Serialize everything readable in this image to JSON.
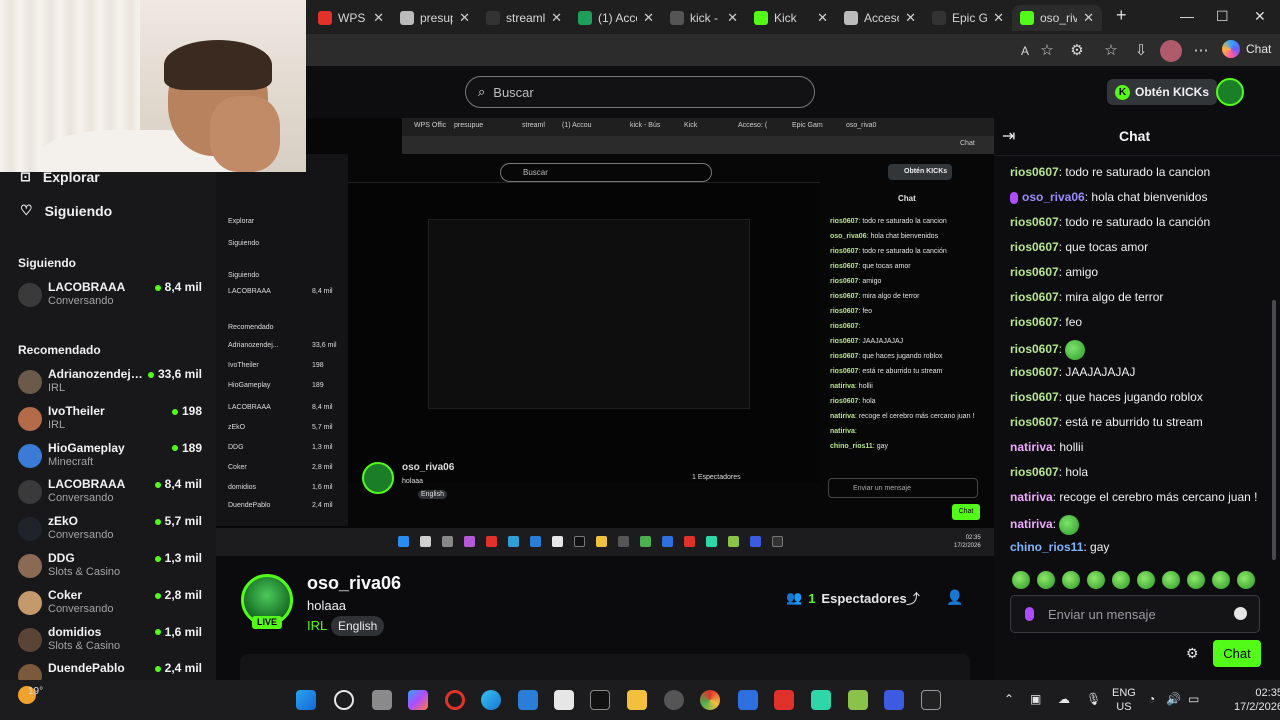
{
  "browser": {
    "tabs": [
      {
        "title": "WPS Offic",
        "color": "#e0322b"
      },
      {
        "title": "presupue",
        "color": "#bbbbbb"
      },
      {
        "title": "streaml",
        "color": "#333333"
      },
      {
        "title": "(1) Accou",
        "color": "#1f9e5a"
      },
      {
        "title": "kick - Bús",
        "color": "#555555"
      },
      {
        "title": "Kick",
        "color": "#53fc18"
      },
      {
        "title": "Acceso: (",
        "color": "#bbbbbb"
      },
      {
        "title": "Epic Gam",
        "color": "#333333"
      },
      {
        "title": "oso_riva0",
        "color": "#53fc18"
      }
    ],
    "copilot_label": "Chat"
  },
  "nav": {
    "search_placeholder": "Buscar",
    "get_kicks_label": "Obtén KICKs"
  },
  "sidebar": {
    "explore_label": "Explorar",
    "following_label": "Siguiendo",
    "following_section": "Siguiendo",
    "recommended_section": "Recomendado",
    "following": [
      {
        "name": "LACOBRAAA",
        "category": "Conversando",
        "viewers": "8,4 mil",
        "avatar_color": "#3a3a3a"
      }
    ],
    "recommended": [
      {
        "name": "Adrianozendejas",
        "category": "IRL",
        "viewers": "33,6 mil",
        "avatar_color": "#6b5a4a"
      },
      {
        "name": "IvoTheiler",
        "category": "IRL",
        "viewers": "198",
        "avatar_color": "#b36b4a"
      },
      {
        "name": "HioGameplay",
        "category": "Minecraft",
        "viewers": "189",
        "avatar_color": "#3b7bd6"
      },
      {
        "name": "LACOBRAAA",
        "category": "Conversando",
        "viewers": "8,4 mil",
        "avatar_color": "#3a3a3a"
      },
      {
        "name": "zEkO",
        "category": "Conversando",
        "viewers": "5,7 mil",
        "avatar_color": "#20232a"
      },
      {
        "name": "DDG",
        "category": "Slots & Casino",
        "viewers": "1,3 mil",
        "avatar_color": "#8a6a55"
      },
      {
        "name": "Coker",
        "category": "Conversando",
        "viewers": "2,8 mil",
        "avatar_color": "#c49a6c"
      },
      {
        "name": "domidios",
        "category": "Slots & Casino",
        "viewers": "1,6 mil",
        "avatar_color": "#5a4436"
      },
      {
        "name": "DuendePablo",
        "category": "",
        "viewers": "2,4 mil",
        "avatar_color": "#7a5a3a"
      }
    ]
  },
  "stream": {
    "streamer": "oso_riva06",
    "title": "holaaa",
    "category": "IRL",
    "tag": "English",
    "live_badge": "LIVE",
    "viewers_count": "1",
    "viewers_label": "Espectadores"
  },
  "chat": {
    "title": "Chat",
    "messages": [
      {
        "user": "rios0607",
        "text": "todo re saturado la cancion",
        "color": "#b7e58f"
      },
      {
        "user": "oso_riva06",
        "text": "hola chat bienvenidos",
        "color": "#9d8cff",
        "mic": true
      },
      {
        "user": "rios0607",
        "text": "todo re saturado la canción",
        "color": "#b7e58f"
      },
      {
        "user": "rios0607",
        "text": "que tocas amor",
        "color": "#b7e58f"
      },
      {
        "user": "rios0607",
        "text": "amigo",
        "color": "#b7e58f"
      },
      {
        "user": "rios0607",
        "text": "mira algo de terror",
        "color": "#b7e58f"
      },
      {
        "user": "rios0607",
        "text": "feo",
        "color": "#b7e58f"
      },
      {
        "user": "rios0607",
        "text": "",
        "color": "#b7e58f",
        "emote": true
      },
      {
        "user": "rios0607",
        "text": "JAAJAJAJAJ",
        "color": "#b7e58f"
      },
      {
        "user": "rios0607",
        "text": "que haces jugando roblox",
        "color": "#b7e58f"
      },
      {
        "user": "rios0607",
        "text": "está re aburrido tu stream",
        "color": "#b7e58f"
      },
      {
        "user": "natiriva",
        "text": "hollii",
        "color": "#f0a8ff"
      },
      {
        "user": "rios0607",
        "text": "hola",
        "color": "#b7e58f"
      },
      {
        "user": "natiriva",
        "text": "recoge el cerebro más cercano juan !",
        "color": "#f0a8ff"
      },
      {
        "user": "natiriva",
        "text": "",
        "color": "#f0a8ff",
        "emote": true
      },
      {
        "user": "chino_rios11",
        "text": "gay",
        "color": "#7fb6ff"
      }
    ],
    "input_placeholder": "Enviar un mensaje",
    "send_label": "Chat"
  },
  "preview": {
    "search": "Buscar",
    "kicks": "Obtén KICKs",
    "chat_title": "Chat",
    "side": [
      "Explorar",
      "Siguiendo",
      "Siguiendo",
      "LACOBRAAA",
      "Recomendado",
      "Adrianozendej...",
      "IvoTheiler",
      "HioGameplay",
      "LACOBRAAA",
      "zEkO",
      "DDG",
      "Coker",
      "domidios",
      "DuendePablo"
    ],
    "side_viewers": [
      "",
      "",
      "",
      "8,4 mil",
      "",
      "33,6 mil",
      "198",
      "189",
      "8,4 mil",
      "5,7 mil",
      "1,3 mil",
      "2,8 mil",
      "1,6 mil",
      "2,4 mil"
    ],
    "streamer": "oso_riva06",
    "title": "holaaa",
    "tag": "English",
    "viewers": "1 Espectadores",
    "input": "Enviar un mensaje",
    "send": "Chat",
    "time": "02:35",
    "date": "17/2/2026"
  },
  "taskbar": {
    "temperature": "19°",
    "lang_top": "ENG",
    "lang_bottom": "US",
    "time": "02:35",
    "date": "17/2/2026"
  }
}
